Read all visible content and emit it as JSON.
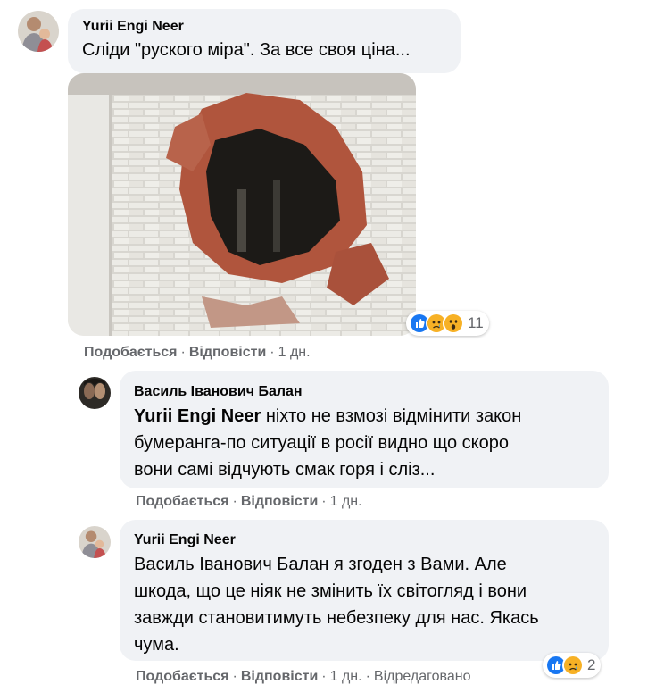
{
  "comments": [
    {
      "author": "Yurii Engi Neer",
      "text": "Сліди \"руского міра\". За все своя ціна...",
      "actions": {
        "like": "Подобається",
        "reply": "Відповісти",
        "time": "1 дн."
      },
      "reactions": {
        "icons": [
          "like-icon",
          "sad-icon",
          "wow-icon"
        ],
        "count": "11"
      },
      "image": "hole-in-brick-wall-photo"
    },
    {
      "author": "Василь Іванович Балан",
      "mention": "Yurii Engi Neer",
      "text_line1": " ніхто не взмозі відмінити закон",
      "text_line2": "бумеранга-по ситуації в росії видно що скоро",
      "text_line3": "вони самі відчують смак горя і сліз...",
      "actions": {
        "like": "Подобається",
        "reply": "Відповісти",
        "time": "1 дн."
      }
    },
    {
      "author": "Yurii Engi Neer",
      "text_line1": "Василь Іванович Балан я згоден з Вами. Але",
      "text_line2": "шкода, що це ніяк не змінить їх світогляд і вони",
      "text_line3": "завжди становитимуть небезпеку для нас. Якась",
      "text_line4": "чума.",
      "actions": {
        "like": "Подобається",
        "reply": "Відповісти",
        "time": "1 дн.",
        "edited": "Відредаговано"
      },
      "reactions": {
        "icons": [
          "like-icon",
          "sad-icon"
        ],
        "count": "2"
      }
    }
  ],
  "colors": {
    "like": "#1877f2",
    "emoji": "#f7b125",
    "bubble": "#f0f2f5",
    "meta": "#65676b"
  },
  "separator": "·"
}
